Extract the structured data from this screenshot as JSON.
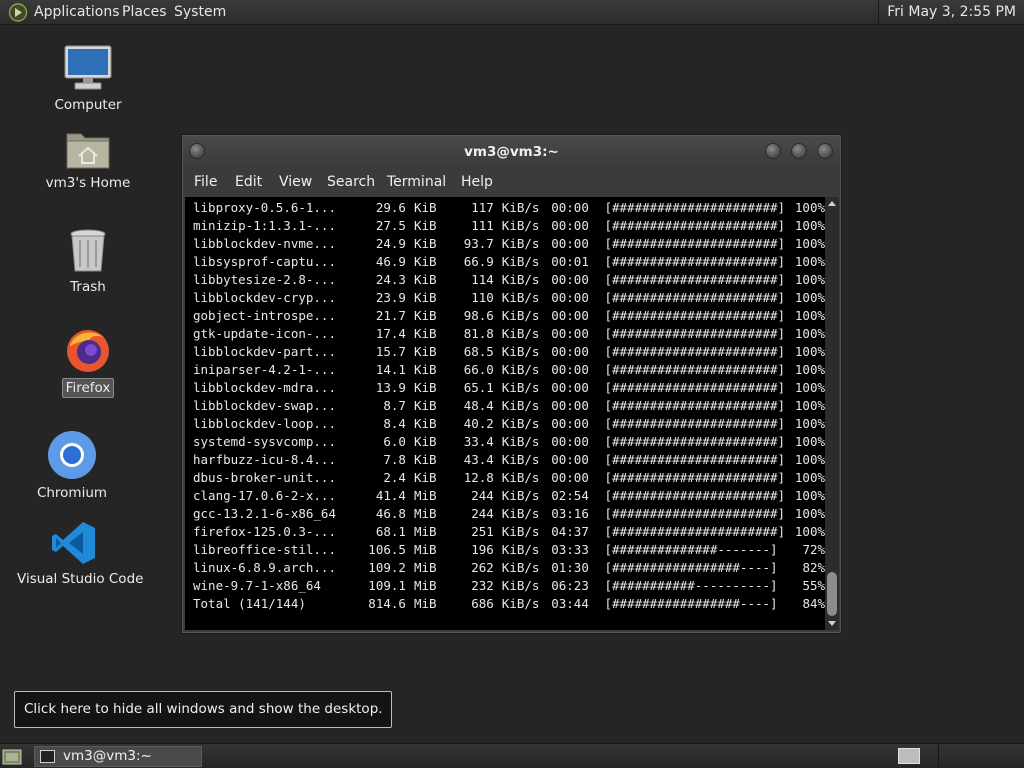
{
  "top_panel": {
    "menu": [
      "Applications",
      "Places",
      "System"
    ],
    "clock": "Fri May  3,  2:55 PM"
  },
  "desktop_icons": {
    "computer": "Computer",
    "home": "vm3's Home",
    "trash": "Trash",
    "firefox": "Firefox",
    "chromium": "Chromium",
    "vscode": "Visual Studio Code"
  },
  "terminal": {
    "title": "vm3@vm3:~",
    "menu": [
      "File",
      "Edit",
      "View",
      "Search",
      "Terminal",
      "Help"
    ],
    "rows": [
      {
        "name": "libproxy-0.5.6-1...",
        "size": "29.6",
        "unit": "KiB",
        "rate": "117",
        "rate_unit": "KiB/s",
        "eta": "00:00",
        "bar": "[######################]",
        "pct": "100%"
      },
      {
        "name": "minizip-1:1.3.1-...",
        "size": "27.5",
        "unit": "KiB",
        "rate": "111",
        "rate_unit": "KiB/s",
        "eta": "00:00",
        "bar": "[######################]",
        "pct": "100%"
      },
      {
        "name": "libblockdev-nvme...",
        "size": "24.9",
        "unit": "KiB",
        "rate": "93.7",
        "rate_unit": "KiB/s",
        "eta": "00:00",
        "bar": "[######################]",
        "pct": "100%"
      },
      {
        "name": "libsysprof-captu...",
        "size": "46.9",
        "unit": "KiB",
        "rate": "66.9",
        "rate_unit": "KiB/s",
        "eta": "00:01",
        "bar": "[######################]",
        "pct": "100%"
      },
      {
        "name": "libbytesize-2.8-...",
        "size": "24.3",
        "unit": "KiB",
        "rate": "114",
        "rate_unit": "KiB/s",
        "eta": "00:00",
        "bar": "[######################]",
        "pct": "100%"
      },
      {
        "name": "libblockdev-cryp...",
        "size": "23.9",
        "unit": "KiB",
        "rate": "110",
        "rate_unit": "KiB/s",
        "eta": "00:00",
        "bar": "[######################]",
        "pct": "100%"
      },
      {
        "name": "gobject-introspe...",
        "size": "21.7",
        "unit": "KiB",
        "rate": "98.6",
        "rate_unit": "KiB/s",
        "eta": "00:00",
        "bar": "[######################]",
        "pct": "100%"
      },
      {
        "name": "gtk-update-icon-...",
        "size": "17.4",
        "unit": "KiB",
        "rate": "81.8",
        "rate_unit": "KiB/s",
        "eta": "00:00",
        "bar": "[######################]",
        "pct": "100%"
      },
      {
        "name": "libblockdev-part...",
        "size": "15.7",
        "unit": "KiB",
        "rate": "68.5",
        "rate_unit": "KiB/s",
        "eta": "00:00",
        "bar": "[######################]",
        "pct": "100%"
      },
      {
        "name": "iniparser-4.2-1-...",
        "size": "14.1",
        "unit": "KiB",
        "rate": "66.0",
        "rate_unit": "KiB/s",
        "eta": "00:00",
        "bar": "[######################]",
        "pct": "100%"
      },
      {
        "name": "libblockdev-mdra...",
        "size": "13.9",
        "unit": "KiB",
        "rate": "65.1",
        "rate_unit": "KiB/s",
        "eta": "00:00",
        "bar": "[######################]",
        "pct": "100%"
      },
      {
        "name": "libblockdev-swap...",
        "size": "8.7",
        "unit": "KiB",
        "rate": "48.4",
        "rate_unit": "KiB/s",
        "eta": "00:00",
        "bar": "[######################]",
        "pct": "100%"
      },
      {
        "name": "libblockdev-loop...",
        "size": "8.4",
        "unit": "KiB",
        "rate": "40.2",
        "rate_unit": "KiB/s",
        "eta": "00:00",
        "bar": "[######################]",
        "pct": "100%"
      },
      {
        "name": "systemd-sysvcomp...",
        "size": "6.0",
        "unit": "KiB",
        "rate": "33.4",
        "rate_unit": "KiB/s",
        "eta": "00:00",
        "bar": "[######################]",
        "pct": "100%"
      },
      {
        "name": "harfbuzz-icu-8.4...",
        "size": "7.8",
        "unit": "KiB",
        "rate": "43.4",
        "rate_unit": "KiB/s",
        "eta": "00:00",
        "bar": "[######################]",
        "pct": "100%"
      },
      {
        "name": "dbus-broker-unit...",
        "size": "2.4",
        "unit": "KiB",
        "rate": "12.8",
        "rate_unit": "KiB/s",
        "eta": "00:00",
        "bar": "[######################]",
        "pct": "100%"
      },
      {
        "name": "clang-17.0.6-2-x...",
        "size": "41.4",
        "unit": "MiB",
        "rate": "244",
        "rate_unit": "KiB/s",
        "eta": "02:54",
        "bar": "[######################]",
        "pct": "100%"
      },
      {
        "name": "gcc-13.2.1-6-x86_64",
        "size": "46.8",
        "unit": "MiB",
        "rate": "244",
        "rate_unit": "KiB/s",
        "eta": "03:16",
        "bar": "[######################]",
        "pct": "100%"
      },
      {
        "name": "firefox-125.0.3-...",
        "size": "68.1",
        "unit": "MiB",
        "rate": "251",
        "rate_unit": "KiB/s",
        "eta": "04:37",
        "bar": "[######################]",
        "pct": "100%"
      },
      {
        "name": "libreoffice-stil...",
        "size": "106.5",
        "unit": "MiB",
        "rate": "196",
        "rate_unit": "KiB/s",
        "eta": "03:33",
        "bar": "[##############-------]",
        "pct": "72%"
      },
      {
        "name": "linux-6.8.9.arch...",
        "size": "109.2",
        "unit": "MiB",
        "rate": "262",
        "rate_unit": "KiB/s",
        "eta": "01:30",
        "bar": "[#################----]",
        "pct": "82%"
      },
      {
        "name": "wine-9.7-1-x86_64",
        "size": "109.1",
        "unit": "MiB",
        "rate": "232",
        "rate_unit": "KiB/s",
        "eta": "06:23",
        "bar": "[###########----------]",
        "pct": "55%"
      },
      {
        "name": "Total (141/144)",
        "size": "814.6",
        "unit": "MiB",
        "rate": "686",
        "rate_unit": "KiB/s",
        "eta": "03:44",
        "bar": "[#################----]",
        "pct": "84%"
      }
    ]
  },
  "tooltip": "Click here to hide all windows and show the desktop.",
  "taskbar": {
    "task_label": "vm3@vm3:~"
  }
}
